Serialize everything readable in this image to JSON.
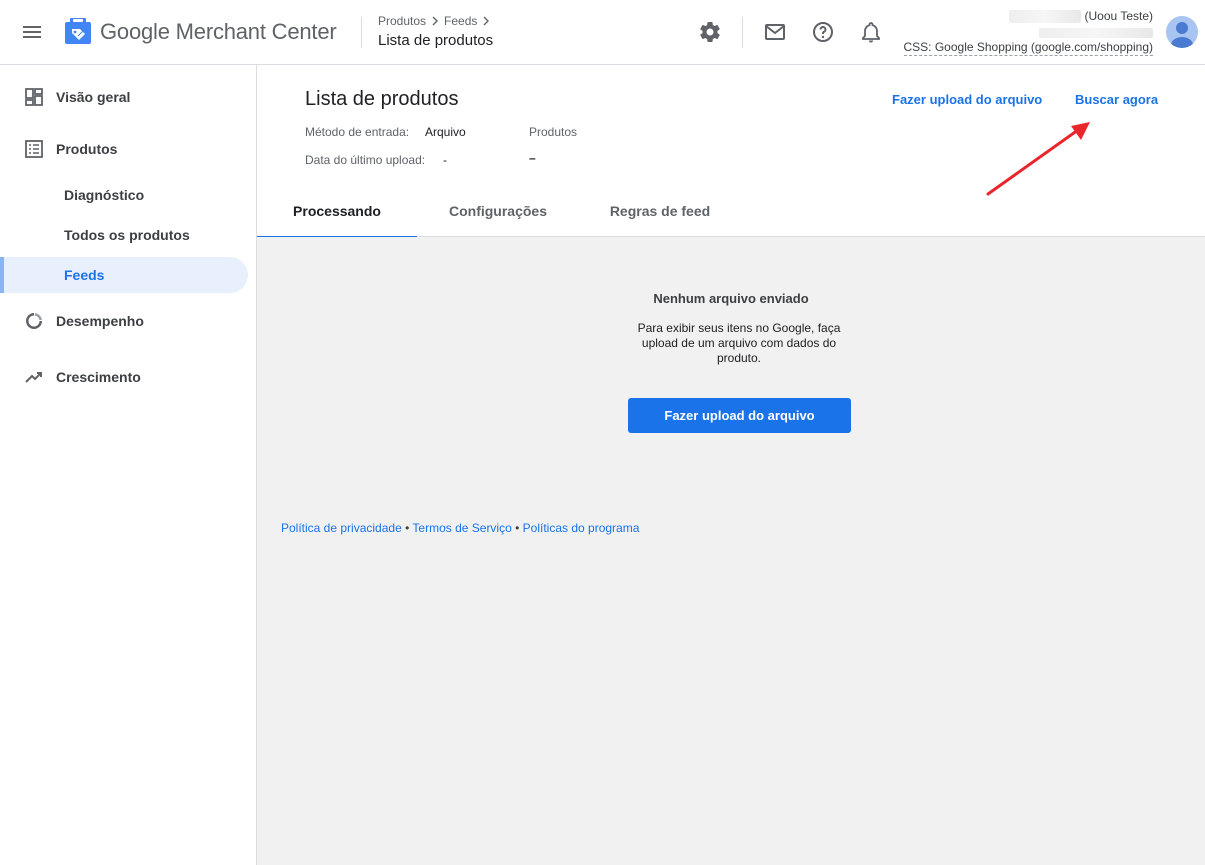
{
  "header": {
    "app_title": "Google Merchant Center",
    "breadcrumb": [
      "Produtos",
      "Feeds"
    ],
    "page_title": "Lista de produtos",
    "account_name_suffix": "(Uoou Teste)",
    "css_label": "CSS: Google Shopping (google.com/shopping)",
    "icons": [
      "menu-icon",
      "merchant-center-logo",
      "settings-icon",
      "mail-icon",
      "help-icon",
      "notifications-icon",
      "account-avatar"
    ]
  },
  "sidebar": {
    "items": [
      {
        "label": "Visão geral",
        "icon": "dashboard-icon"
      },
      {
        "label": "Produtos",
        "icon": "list-icon"
      },
      {
        "label": "Diagnóstico"
      },
      {
        "label": "Todos os produtos"
      },
      {
        "label": "Feeds",
        "active": true
      },
      {
        "label": "Desempenho",
        "icon": "donut-icon"
      },
      {
        "label": "Crescimento",
        "icon": "trending-up-icon"
      }
    ]
  },
  "main": {
    "title": "Lista de produtos",
    "meta": {
      "input_method_label": "Método de entrada:",
      "input_method_value": "Arquivo",
      "products_label": "Produtos",
      "products_value": "–",
      "last_upload_label": "Data do último upload:",
      "last_upload_value": "-"
    },
    "actions": {
      "upload": "Fazer upload do arquivo",
      "fetch_now": "Buscar agora"
    },
    "tabs": [
      {
        "label": "Processando",
        "active": true
      },
      {
        "label": "Configurações"
      },
      {
        "label": "Regras de feed"
      }
    ],
    "empty_state": {
      "title": "Nenhum arquivo enviado",
      "description": "Para exibir seus itens no Google, faça upload de um arquivo com dados do produto.",
      "button": "Fazer upload do arquivo"
    },
    "footer": {
      "privacy": "Política de privacidade",
      "separator": " • ",
      "terms": "Termos de Serviço",
      "program_policies": "Políticas do programa"
    }
  },
  "colors": {
    "accent": "#1a73e8",
    "annotation_arrow": "#e8262b"
  }
}
